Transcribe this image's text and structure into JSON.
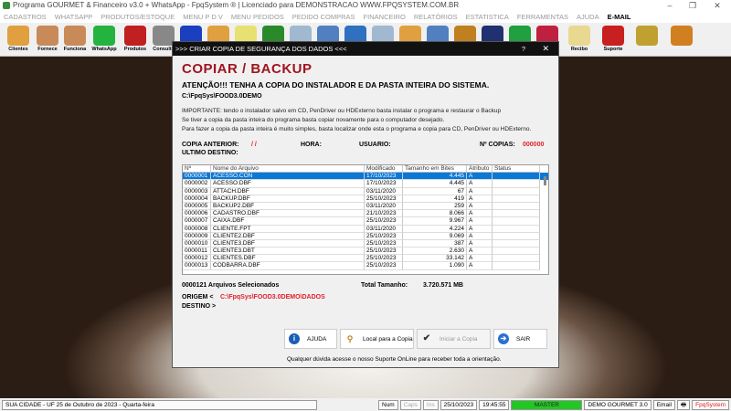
{
  "window": {
    "title": "Programa GOURMET & Financeiro v3.0 + WhatsApp - FpqSystem ® | Licenciado para  DEMONSTRACAO WWW.FPQSYSTEM.COM.BR",
    "minimize": "–",
    "maximize": "❐",
    "close": "✕"
  },
  "menu": [
    "CADASTROS",
    "WHATSAPP",
    "PRODUTOS/ESTOQUE",
    "MENU P D V",
    "MENU PEDIDOS",
    "PEDIDO COMPRAS",
    "FINANCEIRO",
    "RELATÓRIOS",
    "ESTATISTICA",
    "FERRAMENTAS",
    "AJUDA",
    "E-MAIL"
  ],
  "toolbar": [
    {
      "label": "Clientes",
      "color": "#e0a040"
    },
    {
      "label": "Fornece",
      "color": "#c98a5a"
    },
    {
      "label": "Funciona",
      "color": "#c98a5a"
    },
    {
      "label": "WhatsApp",
      "color": "#25b340"
    },
    {
      "label": "Produtos",
      "color": "#c02020"
    },
    {
      "label": "Consulta",
      "color": "#888888"
    },
    {
      "label": "Recibo",
      "color": "#e8d890"
    },
    {
      "label": "Suporte",
      "color": "#c82020"
    },
    {
      "label": "",
      "color": "#c0a030"
    },
    {
      "label": "",
      "color": "#d08020"
    }
  ],
  "dialog": {
    "title": ">>> CRIAR COPIA DE SEGURANÇA DOS DADOS <<<",
    "help": "?",
    "close": "✕",
    "heading": "COPIAR / BACKUP",
    "warning": "ATENÇÃO!!!  TENHA A COPIA DO  INSTALADOR  E  DA PASTA INTEIRA DO  SISTEMA.",
    "path": "C:\\FpqSys\\FOOD3.0DEMO",
    "info": [
      "IMPORTANTE: tendo o instalador salvo em CD, PenDriver ou HDExterno basta instalar o programa e restaurar o Backup",
      "Se tiver a copia da pasta inteira do programa basta copiar novamente para o computador desejado.",
      "Para fazer a copia da pasta inteira é muito simples, basta localizar onde esta o programa e copia para CD, PenDriver ou HDExterno."
    ],
    "copia_anterior_label": "COPIA ANTERIOR:",
    "copia_anterior": "/ /",
    "hora_label": "HORA:",
    "usuario_label": "USUARIO:",
    "ncopias_label": "Nº COPIAS:",
    "ncopias": "000000",
    "ultimo_destino_label": "ULTIMO DESTINO:",
    "columns": [
      "Nº",
      "Nome do Arquivo",
      "Modificado",
      "Tamanho em Bites",
      "Atributo",
      "Status"
    ],
    "rows": [
      [
        "0000001",
        "ACESSO.CON",
        "17/10/2023",
        "4.445",
        "A",
        ""
      ],
      [
        "0000002",
        "ACESSO.DBF",
        "17/10/2023",
        "4.445",
        "A",
        ""
      ],
      [
        "0000003",
        "ATTACH.DBF",
        "03/11/2020",
        "67",
        "A",
        ""
      ],
      [
        "0000004",
        "BACKUP.DBF",
        "25/10/2023",
        "419",
        "A",
        ""
      ],
      [
        "0000005",
        "BACKUP2.DBF",
        "03/11/2020",
        "259",
        "A",
        ""
      ],
      [
        "0000006",
        "CADASTRO.DBF",
        "21/10/2023",
        "8.066",
        "A",
        ""
      ],
      [
        "0000007",
        "CAIXA.DBF",
        "25/10/2023",
        "9.967",
        "A",
        ""
      ],
      [
        "0000008",
        "CLIENTE.FPT",
        "03/11/2020",
        "4.224",
        "A",
        ""
      ],
      [
        "0000009",
        "CLIENTE2.DBF",
        "25/10/2023",
        "9.069",
        "A",
        ""
      ],
      [
        "0000010",
        "CLIENTE3.DBF",
        "25/10/2023",
        "387",
        "A",
        ""
      ],
      [
        "0000011",
        "CLIENTE3.DBT",
        "25/10/2023",
        "2.630",
        "A",
        ""
      ],
      [
        "0000012",
        "CLIENTES.DBF",
        "25/10/2023",
        "33.142",
        "A",
        ""
      ],
      [
        "0000013",
        "CODBARRA.DBF",
        "25/10/2023",
        "1.090",
        "A",
        ""
      ]
    ],
    "selected_count": "0000121 Arquivos  Selecionados",
    "total_label": "Total Tamanho:",
    "total": "3.720.571 MB",
    "origem_label": "ORIGEM  <",
    "origem": "C:\\FpqSys\\FOOD3.0DEMO\\DADOS",
    "destino_label": "DESTINO >",
    "buttons": {
      "ajuda": "AJUDA",
      "local": "Local para a Copia",
      "iniciar": "Iniciar a Copia",
      "sair": "SAIR"
    },
    "footer": "Qualquer dúvida acesse o nosso Suporte OnLine para receber toda a orientação."
  },
  "status": {
    "city": "SUA CIDADE - UF 25 de Outubro de 2023 - Quarta-feira",
    "num": "Num",
    "caps": "Caps",
    "ins": "Ins",
    "date": "25/10/2023",
    "time": "19:45:55",
    "user": "MASTER",
    "company": "DEMO GOURMET 3.0",
    "email": "Email",
    "brand": "FpqSystem"
  }
}
